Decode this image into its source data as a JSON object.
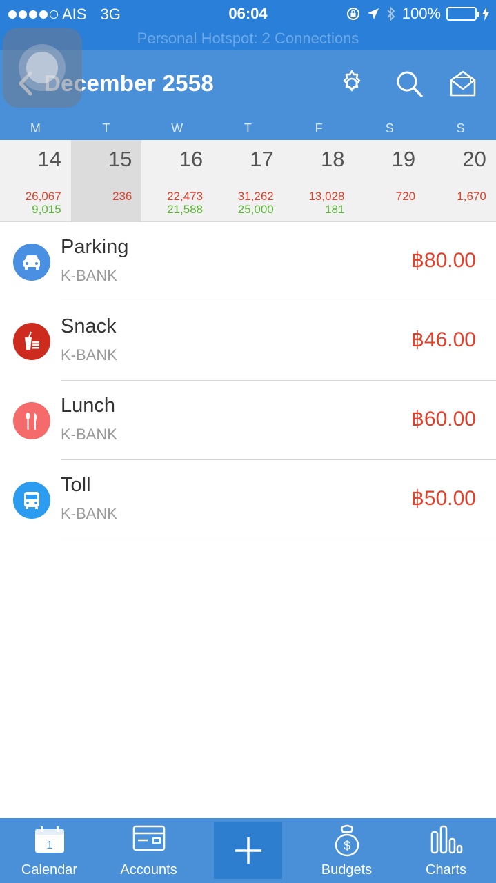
{
  "status_bar": {
    "carrier": "AIS",
    "network": "3G",
    "time": "06:04",
    "battery": "100%"
  },
  "hotspot_banner": "Personal Hotspot: 2 Connections",
  "header": {
    "title": "December 2558"
  },
  "weekdays": [
    "M",
    "T",
    "W",
    "T",
    "F",
    "S",
    "S"
  ],
  "week": [
    {
      "day": "14",
      "expense": "26,067",
      "income": "9,015"
    },
    {
      "day": "15",
      "expense": "236",
      "income": ""
    },
    {
      "day": "16",
      "expense": "22,473",
      "income": "21,588"
    },
    {
      "day": "17",
      "expense": "31,262",
      "income": "25,000"
    },
    {
      "day": "18",
      "expense": "13,028",
      "income": "181"
    },
    {
      "day": "19",
      "expense": "720",
      "income": ""
    },
    {
      "day": "20",
      "expense": "1,670",
      "income": ""
    }
  ],
  "selected_day": "15",
  "transactions": [
    {
      "title": "Parking",
      "account": "K-BANK",
      "amount": "฿80.00",
      "icon": "car-icon",
      "color": "#4a90e2"
    },
    {
      "title": "Snack",
      "account": "K-BANK",
      "amount": "฿46.00",
      "icon": "snack-icon",
      "color": "#cc2b1e"
    },
    {
      "title": "Lunch",
      "account": "K-BANK",
      "amount": "฿60.00",
      "icon": "utensils-icon",
      "color": "#f56a6a"
    },
    {
      "title": "Toll",
      "account": "K-BANK",
      "amount": "฿50.00",
      "icon": "bus-icon",
      "color": "#2b9cf0"
    }
  ],
  "tabbar": {
    "calendar": "Calendar",
    "calendar_day": "1",
    "accounts": "Accounts",
    "budgets": "Budgets",
    "charts": "Charts"
  },
  "colors": {
    "header": "#4a90d9",
    "status_bar": "#2a7fd8",
    "expense": "#e2402a",
    "income": "#5bb336"
  }
}
